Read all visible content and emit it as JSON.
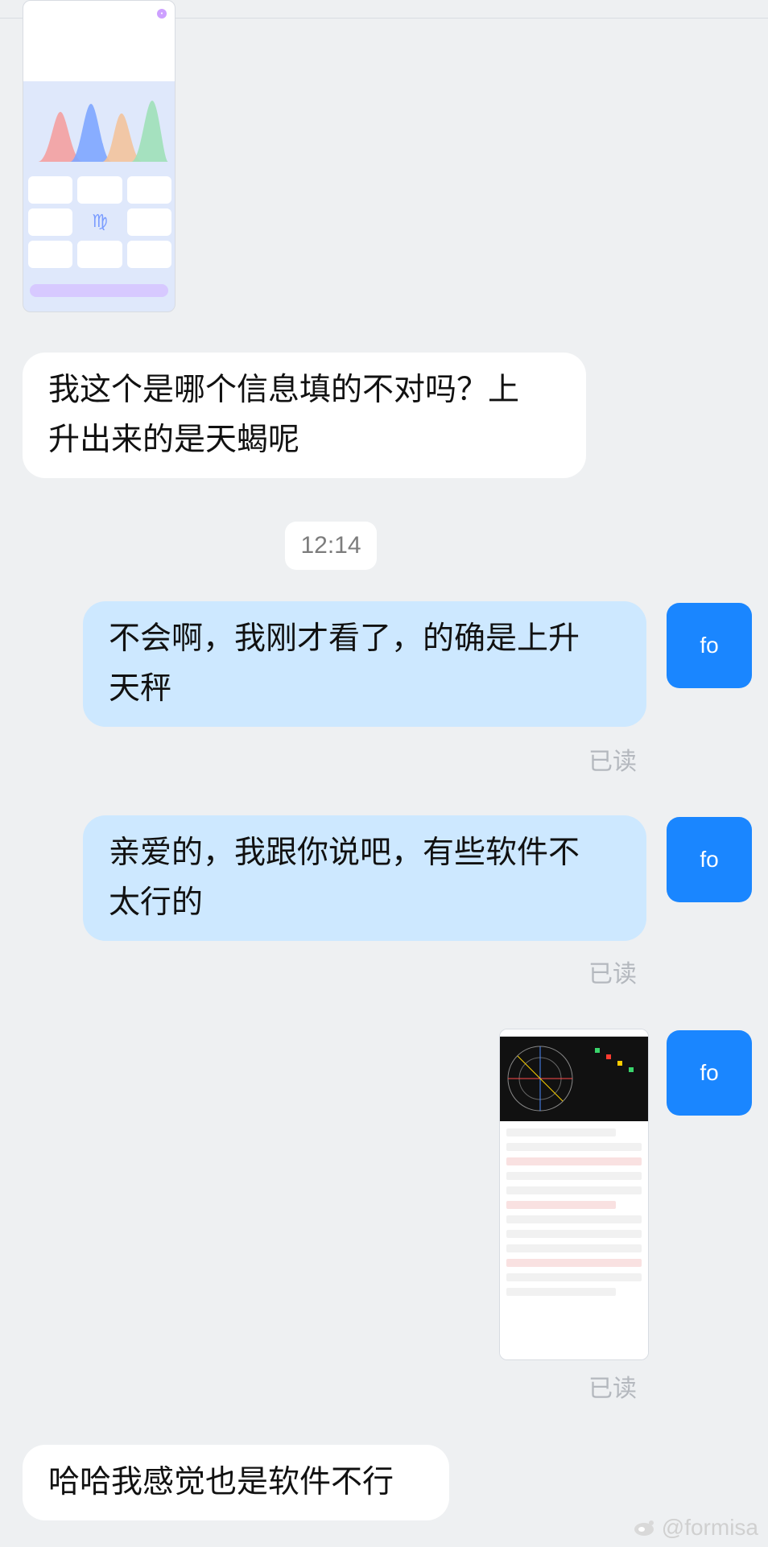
{
  "chat": {
    "messages": {
      "incoming_question": "我这个是哪个信息填的不对吗？上\n升出来的是天蝎呢",
      "timestamp": "12:14",
      "outgoing_1": "不会啊，我刚才看了，的确是上升\n天秤",
      "outgoing_2": "亲爱的，我跟你说吧，有些软件不\n太行的",
      "incoming_2": "哈哈我感觉也是软件不行"
    },
    "avatars": {
      "user_initials": "fo"
    },
    "read_label": "已读",
    "watermark_label": "@formisa"
  }
}
